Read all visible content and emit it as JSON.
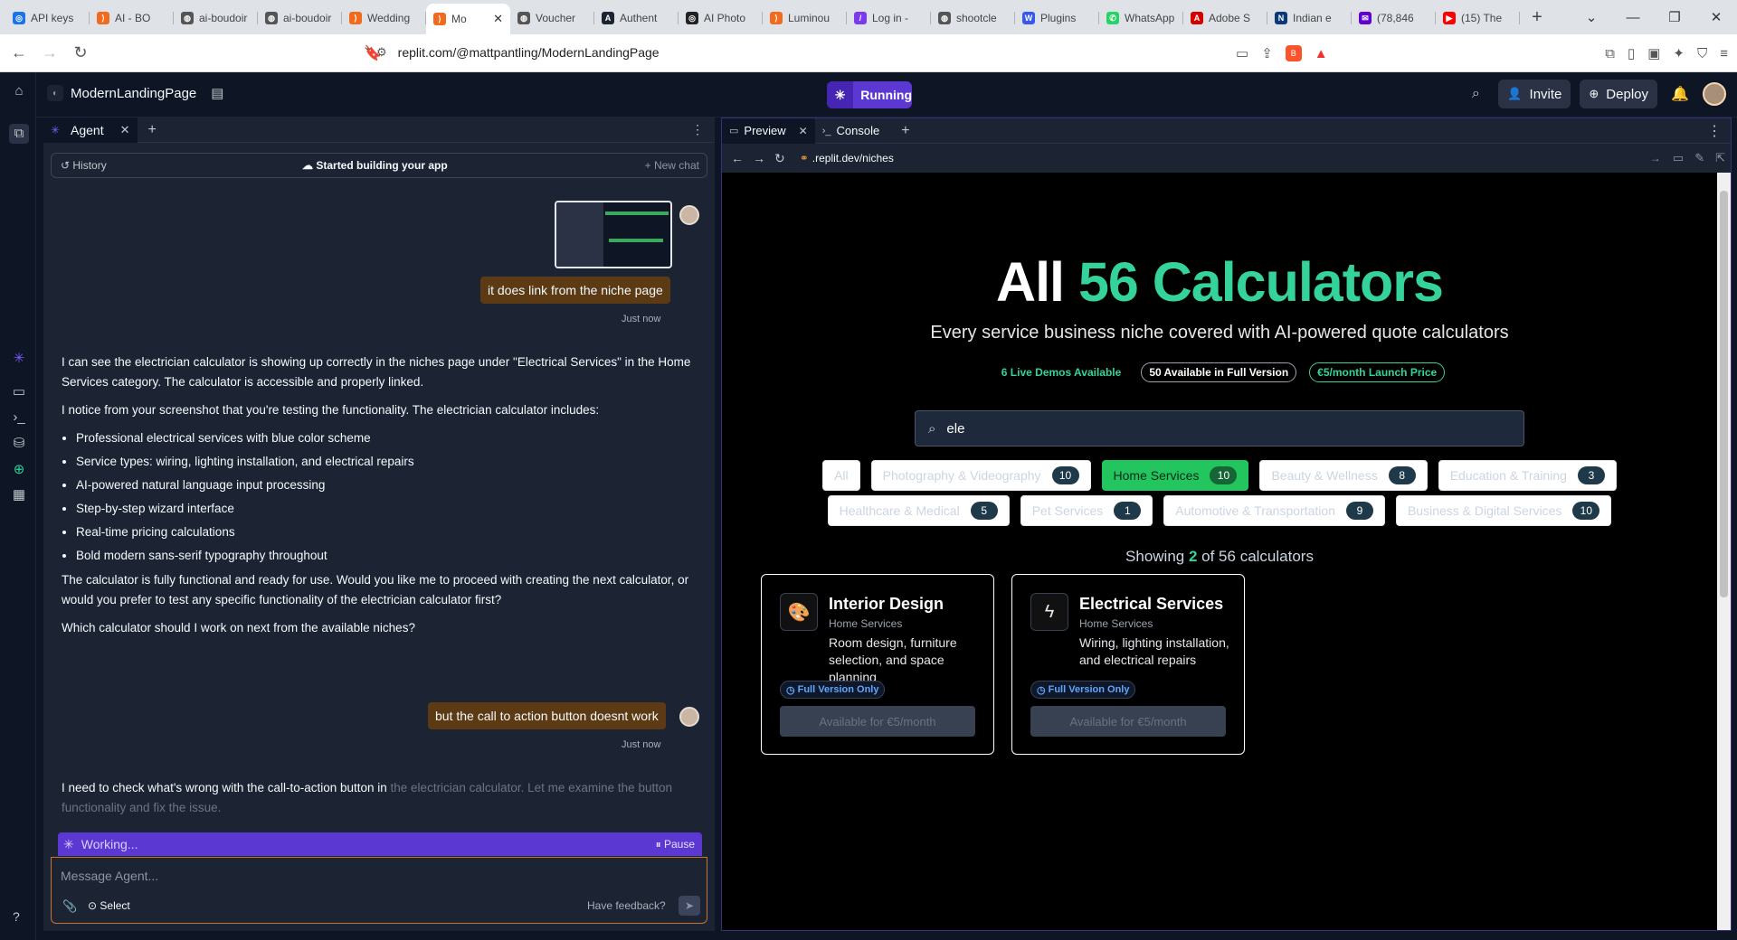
{
  "browser": {
    "tabs": [
      {
        "label": "API keys",
        "color": "#1a73e8",
        "glyph": "◎"
      },
      {
        "label": "AI - BO",
        "color": "#f26b1d",
        "glyph": "⟩"
      },
      {
        "label": "ai-boudoir",
        "color": "#555555",
        "glyph": "◍"
      },
      {
        "label": "ai-boudoir",
        "color": "#555555",
        "glyph": "◍"
      },
      {
        "label": "Wedding",
        "color": "#f26b1d",
        "glyph": "⟩"
      },
      {
        "label": "Mo",
        "color": "#f26b1d",
        "glyph": "⟩"
      },
      {
        "label": "Voucher",
        "color": "#555555",
        "glyph": "◍"
      },
      {
        "label": "Authent",
        "color": "#1c2333",
        "glyph": "A"
      },
      {
        "label": "AI Photo",
        "color": "#222222",
        "glyph": "◎"
      },
      {
        "label": "Luminou",
        "color": "#f26b1d",
        "glyph": "⟩"
      },
      {
        "label": "Log in -",
        "color": "#7c3aed",
        "glyph": "/"
      },
      {
        "label": "shootcle",
        "color": "#555555",
        "glyph": "◍"
      },
      {
        "label": "Plugins",
        "color": "#3858e9",
        "glyph": "W"
      },
      {
        "label": "WhatsApp",
        "color": "#25d366",
        "glyph": "✆"
      },
      {
        "label": "Adobe S",
        "color": "#d40000",
        "glyph": "A"
      },
      {
        "label": "Indian e",
        "color": "#0a3a7a",
        "glyph": "N"
      },
      {
        "label": "(78,846",
        "color": "#6001d2",
        "glyph": "✉"
      },
      {
        "label": "(15) The",
        "color": "#ff0000",
        "glyph": "▶"
      }
    ],
    "active_tab_index": 5,
    "url": "replit.com/@mattpantling/ModernLandingPage"
  },
  "workspace": {
    "project_name": "ModernLandingPage",
    "run_label": "Running",
    "invite_label": "Invite",
    "deploy_label": "Deploy"
  },
  "agent": {
    "tab_label": "Agent",
    "history_label": "History",
    "status_title": "Started building your app",
    "new_chat_label": "New chat",
    "user_msg_1": "it does link from the niche page",
    "ts_1": "Just now",
    "reply_p1": "I can see the electrician calculator is showing up correctly in the niches page under \"Electrical Services\" in the Home Services category. The calculator is accessible and properly linked.",
    "reply_p2": "I notice from your screenshot that you're testing the functionality. The electrician calculator includes:",
    "reply_list": [
      "Professional electrical services with blue color scheme",
      "Service types: wiring, lighting installation, and electrical repairs",
      "AI-powered natural language input processing",
      "Step-by-step wizard interface",
      "Real-time pricing calculations",
      "Bold modern sans-serif typography throughout"
    ],
    "reply_p3": "The calculator is fully functional and ready for use. Would you like me to proceed with creating the next calculator, or would you prefer to test any specific functionality of the electrician calculator first?",
    "reply_p4": "Which calculator should I work on next from the available niches?",
    "user_msg_2": "but the call to action button doesnt work",
    "ts_2": "Just now",
    "reply2_a": "I need to check what's wrong with the call-to-action button in ",
    "reply2_b": "the electrician calculator. ",
    "reply2_c": "Let me examine the button ",
    "reply2_d": "functionality and fix the issue.",
    "working_label": "Working...",
    "pause_label": "Pause",
    "input_placeholder": "Message Agent...",
    "select_label": "Select",
    "feedback_label": "Have feedback?"
  },
  "preview": {
    "tab_preview": "Preview",
    "tab_console": "Console",
    "url_prefix": ".replit.dev",
    "url_path": "/niches",
    "site": {
      "title_a": "All ",
      "title_b": "56 Calculators",
      "subtitle": "Every service business niche covered with AI-powered quote calculators",
      "pill_1": "6 Live Demos Available",
      "pill_2": "50 Available in Full Version",
      "pill_3": "€5/month Launch Price",
      "search_value": "ele",
      "categories_row1": [
        {
          "label": "All",
          "count": null,
          "active": false
        },
        {
          "label": "Photography & Videography",
          "count": "10",
          "active": false
        },
        {
          "label": "Home Services",
          "count": "10",
          "active": true
        },
        {
          "label": "Beauty & Wellness",
          "count": "8",
          "active": false
        },
        {
          "label": "Education & Training",
          "count": "3",
          "active": false
        }
      ],
      "categories_row2": [
        {
          "label": "Healthcare & Medical",
          "count": "5",
          "active": false
        },
        {
          "label": "Pet Services",
          "count": "1",
          "active": false
        },
        {
          "label": "Automotive & Transportation",
          "count": "9",
          "active": false
        },
        {
          "label": "Business & Digital Services",
          "count": "10",
          "active": false
        }
      ],
      "showing_a": "Showing ",
      "showing_n": "2",
      "showing_b": " of 56 calculators",
      "cards": [
        {
          "icon": "palette-icon",
          "glyph": "🎨",
          "title": "Interior Design",
          "category": "Home Services",
          "desc": "Room design, furniture selection, and space planning",
          "badge": "Full Version Only",
          "action": "Available for €5/month"
        },
        {
          "icon": "lightning-icon",
          "glyph": "ϟ",
          "title": "Electrical Services",
          "category": "Home Services",
          "desc": "Wiring, lighting installation, and electrical repairs",
          "badge": "Full Version Only",
          "action": "Available for €5/month"
        }
      ]
    }
  }
}
